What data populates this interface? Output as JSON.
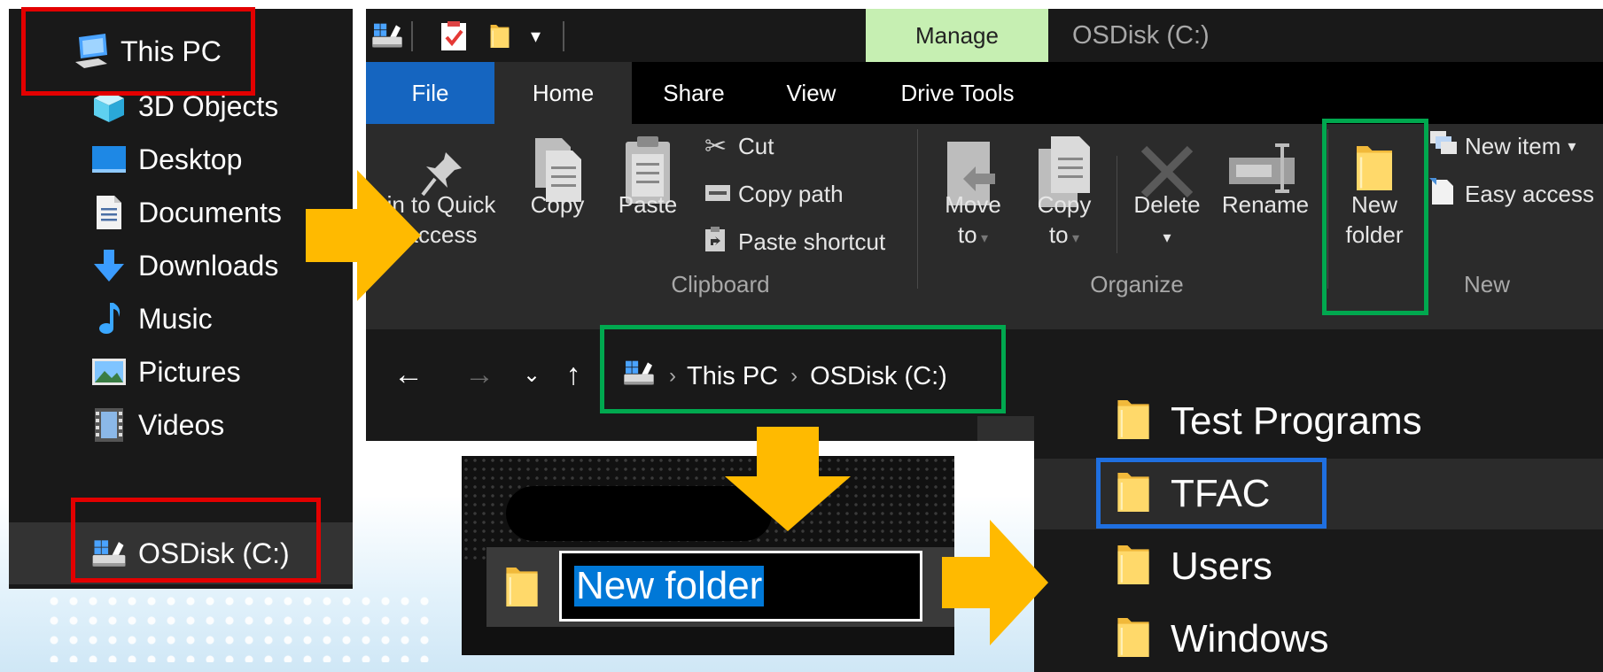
{
  "nav_pane": {
    "items": [
      {
        "label": "This PC",
        "icon": "computer-icon"
      },
      {
        "label": "3D Objects",
        "icon": "cube-icon"
      },
      {
        "label": "Desktop",
        "icon": "desktop-icon"
      },
      {
        "label": "Documents",
        "icon": "document-icon"
      },
      {
        "label": "Downloads",
        "icon": "download-arrow-icon"
      },
      {
        "label": "Music",
        "icon": "music-note-icon"
      },
      {
        "label": "Pictures",
        "icon": "picture-icon"
      },
      {
        "label": "Videos",
        "icon": "film-icon"
      },
      {
        "label": "OSDisk (C:)",
        "icon": "drive-icon"
      }
    ]
  },
  "window": {
    "context_tab": "Manage",
    "title": "OSDisk (C:)",
    "tabs": [
      "File",
      "Home",
      "Share",
      "View",
      "Drive Tools"
    ],
    "active_tab": "Home",
    "clipboard": {
      "pin_label_line1": "in to Quick",
      "pin_label_line2": "access",
      "copy": "Copy",
      "paste": "Paste",
      "cut": "Cut",
      "copy_path": "Copy path",
      "paste_shortcut": "Paste shortcut",
      "group": "Clipboard"
    },
    "organize": {
      "move_line1": "Move",
      "move_line2": "to",
      "copy_line1": "Copy",
      "copy_line2": "to",
      "delete": "Delete",
      "rename": "Rename",
      "group": "Organize"
    },
    "new": {
      "new_folder_line1": "New",
      "new_folder_line2": "folder",
      "new_item": "New item",
      "easy_access": "Easy access",
      "group": "New"
    },
    "address": {
      "crumbs": [
        "This PC",
        "OSDisk (C:)"
      ]
    }
  },
  "rename": {
    "value": "New folder"
  },
  "folder_list": {
    "items": [
      "Test Programs",
      "TFAC",
      "Users",
      "Windows"
    ]
  },
  "colors": {
    "highlight_red": "#e30000",
    "highlight_green": "#00a84f",
    "highlight_blue": "#1f6fe0",
    "arrow": "#ffba00",
    "manage_tab": "#c6efb2",
    "file_tab": "#1565c0",
    "folder": "#f5c94a"
  }
}
